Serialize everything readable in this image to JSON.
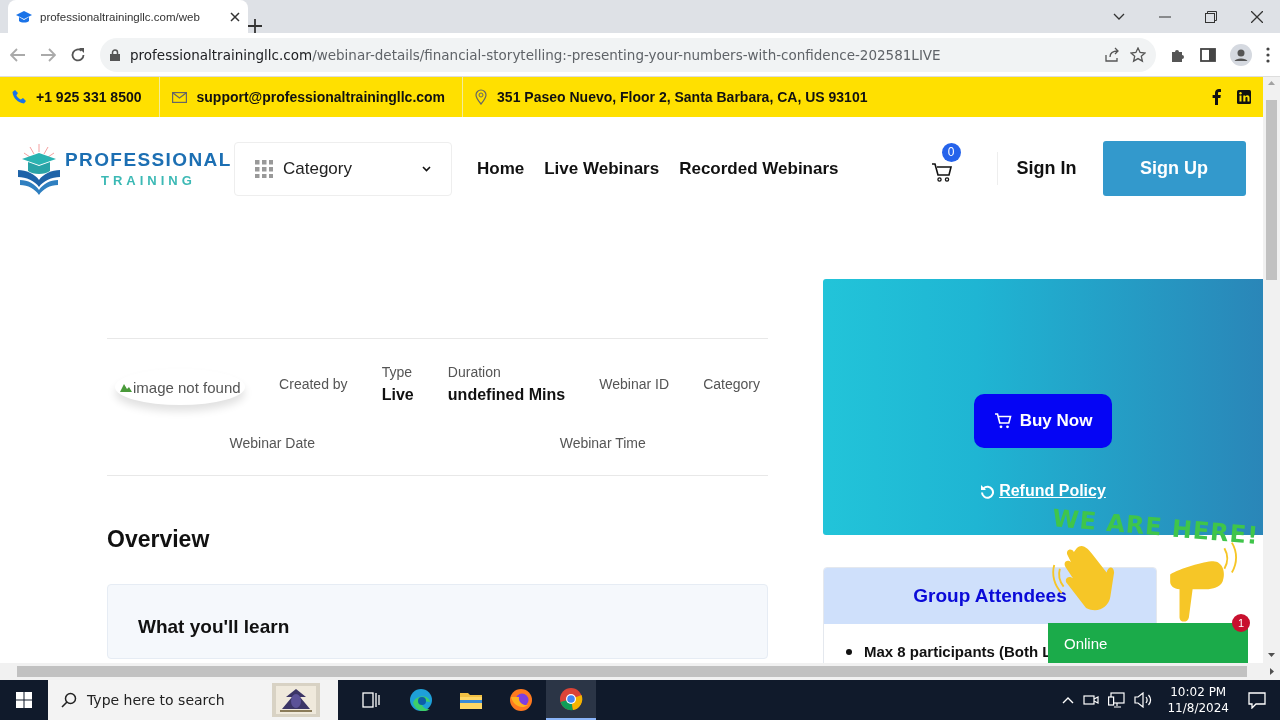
{
  "browser": {
    "tab_title": "professionaltrainingllc.com/web",
    "url_host": "professionaltrainingllc.com",
    "url_path": "/webinar-details/financial-storytelling:-presenting-your-numbers-with-confidence-202581LIVE"
  },
  "contact_bar": {
    "phone": "+1 925 331 8500",
    "email": "support@professionaltrainingllc.com",
    "address": "351 Paseo Nuevo, Floor 2, Santa Barbara, CA, US 93101"
  },
  "header": {
    "logo_line1": "PROFESSIONAL",
    "logo_line2": "TRAINING",
    "category": "Category",
    "nav": [
      "Home",
      "Live Webinars",
      "Recorded Webinars"
    ],
    "cart_count": "0",
    "sign_in": "Sign In",
    "sign_up": "Sign Up"
  },
  "details": {
    "image_alt": "image not found",
    "created_by": "Created by",
    "fields": [
      {
        "label": "Type",
        "value": "Live"
      },
      {
        "label": "Duration",
        "value": "undefined Mins"
      },
      {
        "label": "Webinar ID"
      },
      {
        "label": "Category"
      }
    ],
    "date_label": "Webinar Date",
    "time_label": "Webinar Time"
  },
  "overview": {
    "title": "Overview",
    "learn_title": "What you'll learn"
  },
  "purchase": {
    "buy": "Buy Now",
    "refund": "Refund Policy"
  },
  "group": {
    "title": "Group Attendees",
    "items": [
      "Max 8 participants (Both L"
    ]
  },
  "chat_widget": {
    "banner": "WE ARE HERE!",
    "status": "Online",
    "badge": "1"
  },
  "taskbar": {
    "search_placeholder": "Type here to search",
    "time": "10:02 PM",
    "date": "11/8/2024"
  }
}
